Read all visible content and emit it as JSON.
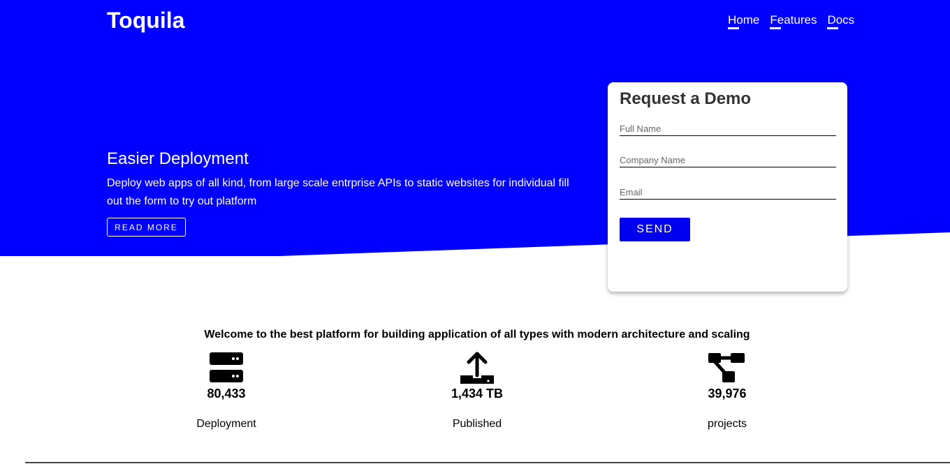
{
  "colors": {
    "brand_blue": "#0000ff",
    "button_blue": "#0000ee",
    "white": "#ffffff"
  },
  "header": {
    "brand": "Toquila",
    "nav": [
      {
        "label": "Home"
      },
      {
        "label": "Features"
      },
      {
        "label": "Docs"
      }
    ]
  },
  "hero": {
    "heading": "Easier Deployment",
    "text": "Deploy web apps of all kind, from large scale entrprise APIs to static websites for individual fill out the form to try out platform",
    "read_more": "READ MORE"
  },
  "demo_form": {
    "title": "Request a Demo",
    "fields": [
      {
        "placeholder": "Full Name",
        "value": ""
      },
      {
        "placeholder": "Company Name",
        "value": ""
      },
      {
        "placeholder": "Email",
        "value": ""
      }
    ],
    "send": "SEND"
  },
  "stats": {
    "welcome": "Welcome to the best platform for building application of all types with modern architecture and scaling",
    "items": [
      {
        "icon": "server-icon",
        "value": "80,433",
        "label": "Deployment"
      },
      {
        "icon": "upload-icon",
        "value": "1,434 TB",
        "label": "Published"
      },
      {
        "icon": "project-diagram-icon",
        "value": "39,976",
        "label": "projects"
      }
    ]
  }
}
